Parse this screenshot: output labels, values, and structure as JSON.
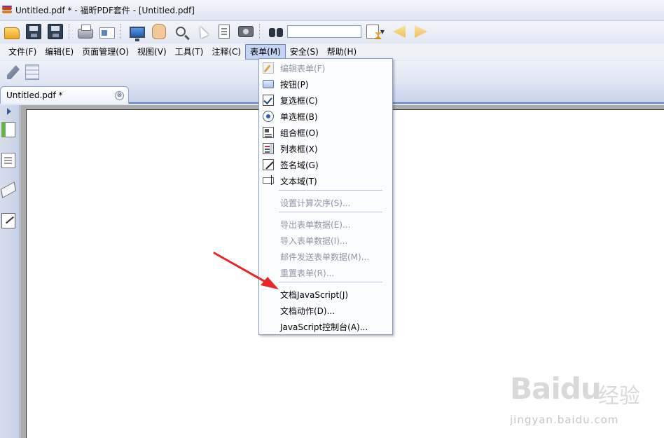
{
  "window": {
    "title": "Untitled.pdf * - 福昕PDF套件 - [Untitled.pdf]"
  },
  "toolbar": {
    "buttons": [
      "open-icon",
      "save-icon",
      "save-all-icon",
      "print-icon",
      "email-icon",
      "fullscreen-icon",
      "hand-icon",
      "zoom-icon",
      "select-cursor-icon",
      "text-select-icon",
      "snapshot-icon",
      "find-icon",
      "find-options-icon",
      "previous-icon",
      "next-icon"
    ],
    "find_value": ""
  },
  "menubar": {
    "items": [
      {
        "label": "文件(F)"
      },
      {
        "label": "编辑(E)"
      },
      {
        "label": "页面管理(O)"
      },
      {
        "label": "视图(V)"
      },
      {
        "label": "工具(T)"
      },
      {
        "label": "注释(C)"
      },
      {
        "label": "表单(M)"
      },
      {
        "label": "安全(S)"
      },
      {
        "label": "帮助(H)"
      }
    ]
  },
  "tabs": {
    "active": {
      "label": "Untitled.pdf *",
      "close": "⊗"
    }
  },
  "dropdown": {
    "items": [
      {
        "label": "编辑表单(F)",
        "icon": "edit-form-icon",
        "disabled": true
      },
      {
        "label": "按钮(P)",
        "icon": "button-field-icon",
        "disabled": false
      },
      {
        "label": "复选框(C)",
        "icon": "checkbox-icon",
        "disabled": false
      },
      {
        "label": "单选框(B)",
        "icon": "radio-icon",
        "disabled": false
      },
      {
        "label": "组合框(O)",
        "icon": "combo-box-icon",
        "disabled": false
      },
      {
        "label": "列表框(X)",
        "icon": "list-box-icon",
        "disabled": false
      },
      {
        "label": "签名域(G)",
        "icon": "signature-icon",
        "disabled": false
      },
      {
        "label": "文本域(T)",
        "icon": "text-field-icon",
        "disabled": false
      },
      {
        "label": "设置计算次序(S)...",
        "disabled": true
      },
      {
        "label": "导出表单数据(E)...",
        "disabled": true
      },
      {
        "label": "导入表单数据(I)...",
        "disabled": true
      },
      {
        "label": "邮件发送表单数据(M)...",
        "disabled": true
      },
      {
        "label": "重置表单(R)...",
        "disabled": true
      },
      {
        "label": "文档JavaScript(J)",
        "disabled": false
      },
      {
        "label": "文档动作(D)...",
        "disabled": false
      },
      {
        "label": "JavaScript控制台(A)...",
        "disabled": false
      }
    ]
  },
  "watermark": {
    "logo": "Baidu",
    "cn": "经验",
    "url": "jingyan.baidu.com"
  },
  "colors": {
    "arrow": "#e8252b",
    "menu_highlight": "#c3d5f3"
  }
}
